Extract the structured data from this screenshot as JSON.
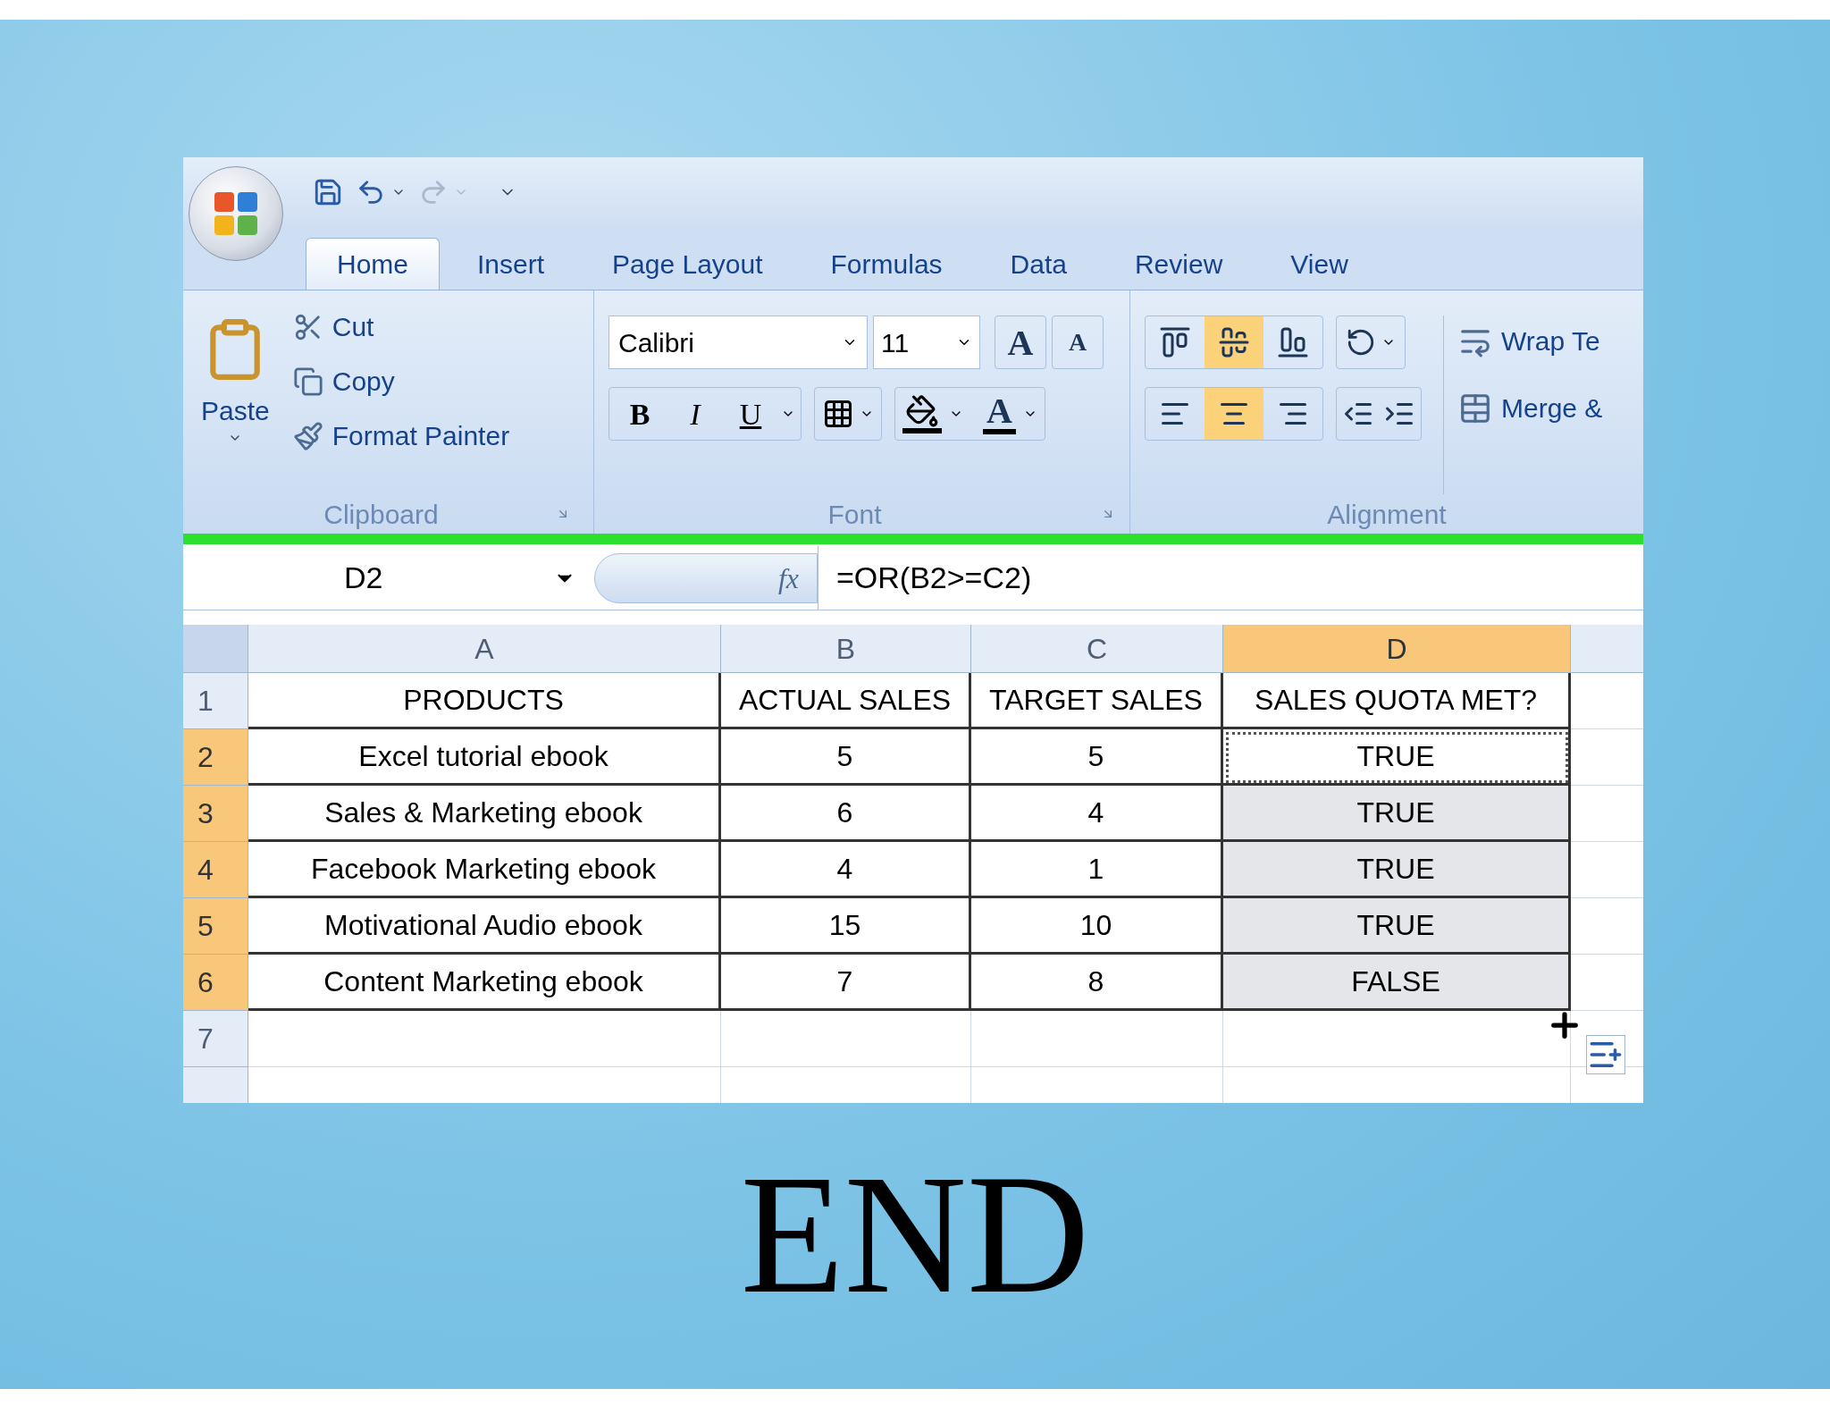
{
  "quick_access": [
    {
      "kind": "save",
      "disabled": false
    },
    {
      "kind": "undo",
      "disabled": false
    },
    {
      "kind": "redo",
      "disabled": true
    }
  ],
  "tabs": [
    {
      "label": "Home",
      "selected": true
    },
    {
      "label": "Insert",
      "selected": false
    },
    {
      "label": "Page Layout",
      "selected": false
    },
    {
      "label": "Formulas",
      "selected": false
    },
    {
      "label": "Data",
      "selected": false
    },
    {
      "label": "Review",
      "selected": false
    },
    {
      "label": "View",
      "selected": false
    }
  ],
  "clipboard": {
    "paste": "Paste",
    "cut": "Cut",
    "copy": "Copy",
    "format_painter": "Format Painter",
    "title": "Clipboard"
  },
  "font": {
    "face": "Calibri",
    "size": "11",
    "grow": "A",
    "shrink": "A",
    "bold": "B",
    "italic": "I",
    "underline": "U",
    "font_color_button": "A",
    "title": "Font"
  },
  "alignment": {
    "vertical": [
      {
        "kind": "top",
        "selected": false
      },
      {
        "kind": "middle",
        "selected": true
      },
      {
        "kind": "bottom",
        "selected": false
      }
    ],
    "horizontal": [
      {
        "kind": "left",
        "selected": false
      },
      {
        "kind": "center",
        "selected": true
      },
      {
        "kind": "right",
        "selected": false
      }
    ],
    "wrap": "Wrap Te",
    "merge": "Merge &",
    "title": "Alignment"
  },
  "formula_bar": {
    "name_box": "D2",
    "function_label": "fx",
    "formula": "=OR(B2>=C2)"
  },
  "columns": [
    {
      "label": "A",
      "selected": false
    },
    {
      "label": "B",
      "selected": false
    },
    {
      "label": "C",
      "selected": false
    },
    {
      "label": "D",
      "selected": true
    }
  ],
  "rows": [
    {
      "label": "1",
      "selected": false,
      "active": false,
      "cells": [
        "PRODUCTS",
        "ACTUAL SALES",
        "TARGET SALES",
        "SALES QUOTA MET?"
      ]
    },
    {
      "label": "2",
      "selected": true,
      "active": true,
      "cells": [
        "Excel tutorial ebook",
        "5",
        "5",
        "TRUE"
      ]
    },
    {
      "label": "3",
      "selected": true,
      "active": false,
      "cells": [
        "Sales & Marketing ebook",
        "6",
        "4",
        "TRUE"
      ]
    },
    {
      "label": "4",
      "selected": true,
      "active": false,
      "cells": [
        "Facebook Marketing ebook",
        "4",
        "1",
        "TRUE"
      ]
    },
    {
      "label": "5",
      "selected": true,
      "active": false,
      "cells": [
        "Motivational Audio ebook",
        "15",
        "10",
        "TRUE"
      ]
    },
    {
      "label": "6",
      "selected": true,
      "active": false,
      "cells": [
        "Content Marketing ebook",
        "7",
        "8",
        "FALSE"
      ]
    },
    {
      "label": "7",
      "selected": false,
      "active": false
    }
  ],
  "caption": "END"
}
